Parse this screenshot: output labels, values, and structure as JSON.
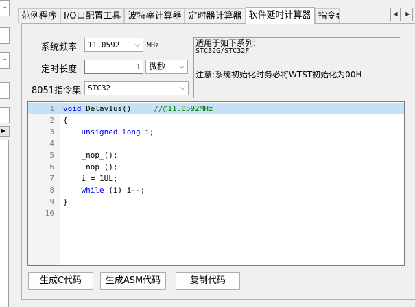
{
  "tabs": [
    {
      "label": "范例程序",
      "active": false
    },
    {
      "label": "I/O口配置工具",
      "active": false
    },
    {
      "label": "波特率计算器",
      "active": false
    },
    {
      "label": "定时器计算器",
      "active": false
    },
    {
      "label": "软件延时计算器",
      "active": true
    },
    {
      "label": "指令表",
      "active": false
    }
  ],
  "tab_scroll": {
    "left": "◀",
    "right": "▶"
  },
  "form": {
    "freq_label": "系统频率",
    "freq_value": "11.0592",
    "freq_unit": "MHz",
    "time_label": "定时长度",
    "time_value": "1",
    "time_unit": "微秒",
    "mcu_label": "8051指令集",
    "mcu_value": "STC32"
  },
  "info": {
    "series_title": "适用于如下系列:",
    "series_list": "STC32G/STC32F",
    "note": "注意:系统初始化时务必将WTST初始化为00H"
  },
  "code_lines": [
    {
      "num": "1",
      "text": "void Delay1us()     //@11.0592MHz"
    },
    {
      "num": "2",
      "text": "{"
    },
    {
      "num": "3",
      "text": "    unsigned long i;"
    },
    {
      "num": "4",
      "text": ""
    },
    {
      "num": "5",
      "text": "    _nop_();"
    },
    {
      "num": "6",
      "text": "    _nop_();"
    },
    {
      "num": "7",
      "text": "    i = 1UL;"
    },
    {
      "num": "8",
      "text": "    while (i) i--;"
    },
    {
      "num": "9",
      "text": "}"
    },
    {
      "num": "10",
      "text": ""
    }
  ],
  "buttons": {
    "gen_c": "生成C代码",
    "gen_asm": "生成ASM代码",
    "copy": "复制代码"
  },
  "colors": {
    "keyword": "#0000ff",
    "comment": "#008000",
    "highlight": "#c4e1f5"
  }
}
